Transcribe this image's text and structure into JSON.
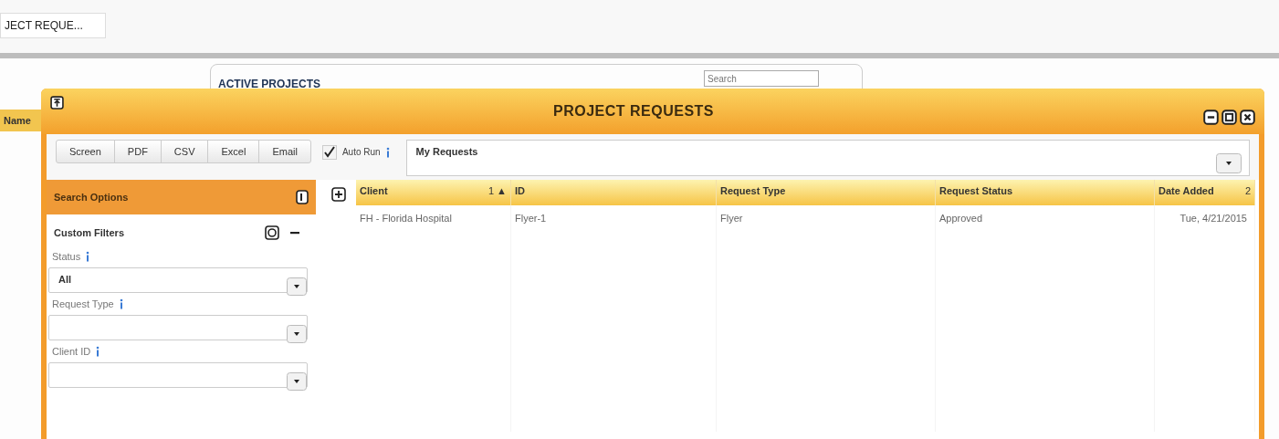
{
  "background": {
    "tab": {
      "label": "JECT REQUE..."
    },
    "heading": "ACTIVE PROJECTS",
    "search": {
      "placeholder": "Search"
    },
    "column_header": "Name"
  },
  "dialog": {
    "title": "PROJECT REQUESTS",
    "export_buttons": [
      "Screen",
      "PDF",
      "CSV",
      "Excel",
      "Email"
    ],
    "auto_run": {
      "label": "Auto Run",
      "checked": true
    },
    "saved_search": {
      "value": "My Requests"
    },
    "search_options": {
      "title": "Search Options",
      "section": "Custom Filters",
      "filters": [
        {
          "label": "Status",
          "value": "All"
        },
        {
          "label": "Request Type"
        },
        {
          "label": "Client ID"
        }
      ]
    },
    "table": {
      "columns": [
        {
          "label": "Client",
          "sort": "1 ▲"
        },
        {
          "label": "ID"
        },
        {
          "label": "Request Type"
        },
        {
          "label": "Request Status"
        },
        {
          "label": "Date Added",
          "sort": "2"
        }
      ],
      "rows": [
        [
          "FH - Florida Hospital",
          "Flyer-1",
          "Flyer",
          "Approved",
          "Tue, 4/21/2015"
        ]
      ]
    }
  }
}
